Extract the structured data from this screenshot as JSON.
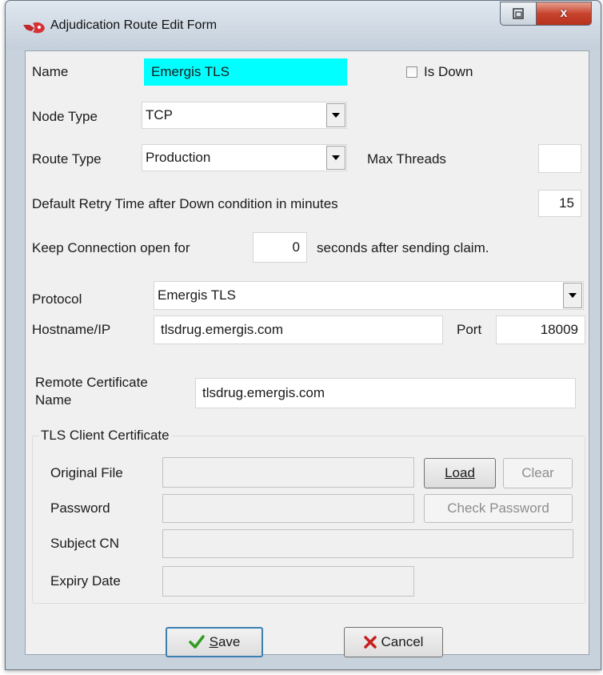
{
  "window": {
    "title": "Adjudication Route Edit Form",
    "close_glyph": "x",
    "icons": [
      "app-icon",
      "restore-icon",
      "close-icon"
    ]
  },
  "form": {
    "name_label": "Name",
    "name_value": "Emergis TLS",
    "name_highlight_color": "#00ffff",
    "is_down_label": "Is Down",
    "is_down_checked": false,
    "node_type_label": "Node Type",
    "node_type_value": "TCP",
    "route_type_label": "Route Type",
    "route_type_value": "Production",
    "max_threads_label": "Max Threads",
    "max_threads_value": "",
    "retry_label": "Default Retry Time after Down condition in minutes",
    "retry_value": "15",
    "keep_conn_label_before": "Keep Connection open for",
    "keep_conn_value": "0",
    "keep_conn_label_after": "seconds after sending claim.",
    "protocol_label": "Protocol",
    "protocol_value": "Emergis TLS",
    "hostname_label": "Hostname/IP",
    "hostname_value": "tlsdrug.emergis.com",
    "port_label": "Port",
    "port_value": "18009",
    "remote_cert_label_line1": "Remote Certificate",
    "remote_cert_label_line2": "Name",
    "remote_cert_value": "tlsdrug.emergis.com"
  },
  "tls_group": {
    "title": "TLS Client Certificate",
    "original_file_label": "Original File",
    "original_file_value": "",
    "load_label": "Load",
    "clear_label": "Clear",
    "password_label": "Password",
    "password_value": "",
    "check_password_label": "Check Password",
    "subject_cn_label": "Subject CN",
    "subject_cn_value": "",
    "expiry_date_label": "Expiry Date",
    "expiry_date_value": ""
  },
  "footer": {
    "save_label": "Save",
    "save_mnemonic": "S",
    "save_rest": "ave",
    "save_icon": "checkmark-icon",
    "save_icon_color": "#2e9c1e",
    "cancel_label": "Cancel",
    "cancel_icon": "x-icon",
    "cancel_icon_color": "#c81e1e"
  }
}
